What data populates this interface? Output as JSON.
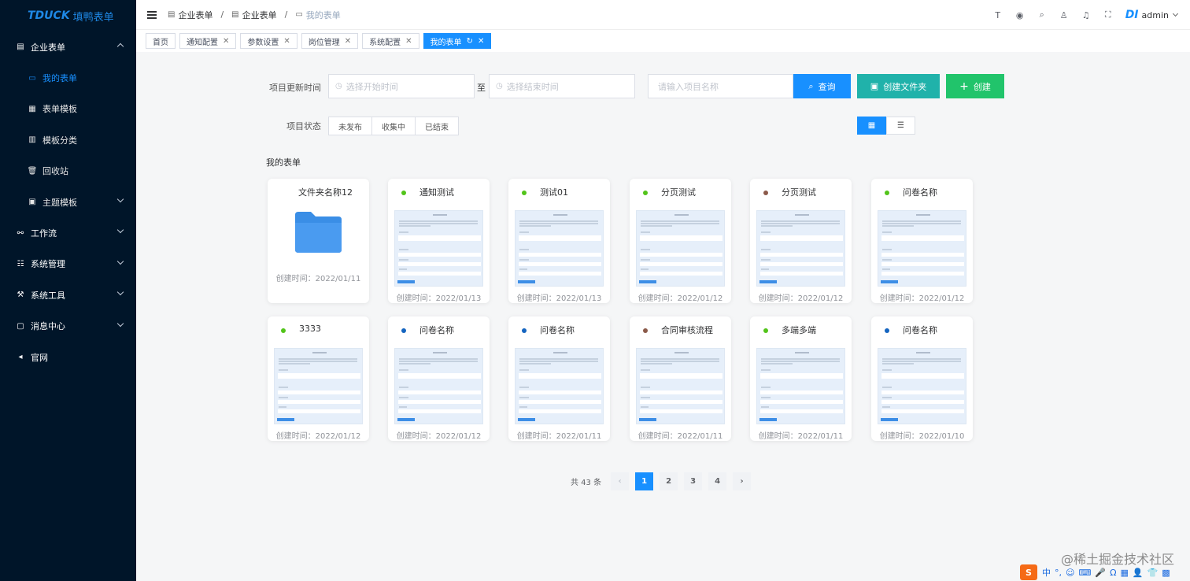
{
  "app": {
    "logo": "TDUCK",
    "logo_cn": "填鸭表单"
  },
  "sidebar": {
    "items": [
      {
        "label": "企业表单",
        "icon": "form-icon",
        "kind": "parent",
        "arrow": "up"
      },
      {
        "label": "我的表单",
        "icon": "doc-icon",
        "kind": "sub",
        "active": true
      },
      {
        "label": "表单模板",
        "icon": "template-icon",
        "kind": "sub"
      },
      {
        "label": "模板分类",
        "icon": "category-icon",
        "kind": "sub"
      },
      {
        "label": "回收站",
        "icon": "trash-icon",
        "kind": "sub"
      },
      {
        "label": "主题模板",
        "icon": "theme-icon",
        "kind": "sub",
        "arrow": "down"
      },
      {
        "label": "工作流",
        "icon": "workflow-icon",
        "kind": "parent",
        "arrow": "down"
      },
      {
        "label": "系统管理",
        "icon": "list-icon",
        "kind": "parent",
        "arrow": "down"
      },
      {
        "label": "系统工具",
        "icon": "tool-icon",
        "kind": "parent",
        "arrow": "down"
      },
      {
        "label": "消息中心",
        "icon": "message-icon",
        "kind": "parent",
        "arrow": "down"
      },
      {
        "label": "官网",
        "icon": "send-icon",
        "kind": "parent"
      }
    ]
  },
  "breadcrumb": [
    "企业表单",
    "企业表单",
    "我的表单"
  ],
  "navbar": {
    "user": "admin",
    "avatar_logo": "DI",
    "tools": [
      "text-icon",
      "github-icon",
      "search-icon",
      "shirt-icon",
      "bell-icon",
      "fullscreen-icon"
    ]
  },
  "tags": [
    {
      "label": "首页",
      "closable": false
    },
    {
      "label": "通知配置",
      "closable": true
    },
    {
      "label": "参数设置",
      "closable": true
    },
    {
      "label": "岗位管理",
      "closable": true
    },
    {
      "label": "系统配置",
      "closable": true
    },
    {
      "label": "我的表单",
      "closable": true,
      "active": true
    }
  ],
  "filters": {
    "update_time_label": "项目更新时间",
    "start_placeholder": "选择开始时间",
    "range_sep": "至",
    "end_placeholder": "选择结束时间",
    "name_placeholder": "请输入项目名称",
    "search_btn": "查询",
    "create_folder_btn": "创建文件夹",
    "create_btn": "创建",
    "status_label": "项目状态",
    "status_options": [
      "未发布",
      "收集中",
      "已结束"
    ]
  },
  "section_title": "我的表单",
  "cards": [
    {
      "name": "文件夹名称12",
      "time": "创建时间：2022/01/11",
      "folder": true
    },
    {
      "name": "通知测试",
      "time": "创建时间：2022/01/13",
      "dot": "#52c41a"
    },
    {
      "name": "测试01",
      "time": "创建时间：2022/01/13",
      "dot": "#52c41a"
    },
    {
      "name": "分页测试",
      "time": "创建时间：2022/01/12",
      "dot": "#52c41a"
    },
    {
      "name": "分页测试",
      "time": "创建时间：2022/01/12",
      "dot": "#8b5a4a"
    },
    {
      "name": "问卷名称",
      "time": "创建时间：2022/01/12",
      "dot": "#52c41a"
    },
    {
      "name": "3333",
      "time": "创建时间：2022/01/12",
      "dot": "#52c41a"
    },
    {
      "name": "问卷名称",
      "time": "创建时间：2022/01/12",
      "dot": "#1565c0"
    },
    {
      "name": "问卷名称",
      "time": "创建时间：2022/01/11",
      "dot": "#1565c0"
    },
    {
      "name": "合同审核流程",
      "time": "创建时间：2022/01/11",
      "dot": "#8b5a4a"
    },
    {
      "name": "多端多端",
      "time": "创建时间：2022/01/11",
      "dot": "#52c41a"
    },
    {
      "name": "问卷名称",
      "time": "创建时间：2022/01/10",
      "dot": "#1565c0"
    }
  ],
  "pagination": {
    "total": "共 43 条",
    "pages": [
      "1",
      "2",
      "3",
      "4"
    ],
    "current": "1"
  },
  "watermark": "@稀土掘金技术社区",
  "ime": {
    "logo": "S",
    "items": [
      "中",
      "°,",
      "☺",
      "⌨",
      "🎤",
      "Ω",
      "▦",
      "👤",
      "👕",
      "▩"
    ]
  },
  "colors": {
    "sidebar_bg": "#001529",
    "primary": "#1890ff",
    "folder_btn": "#20b2aa",
    "create_btn": "#21c46b"
  }
}
